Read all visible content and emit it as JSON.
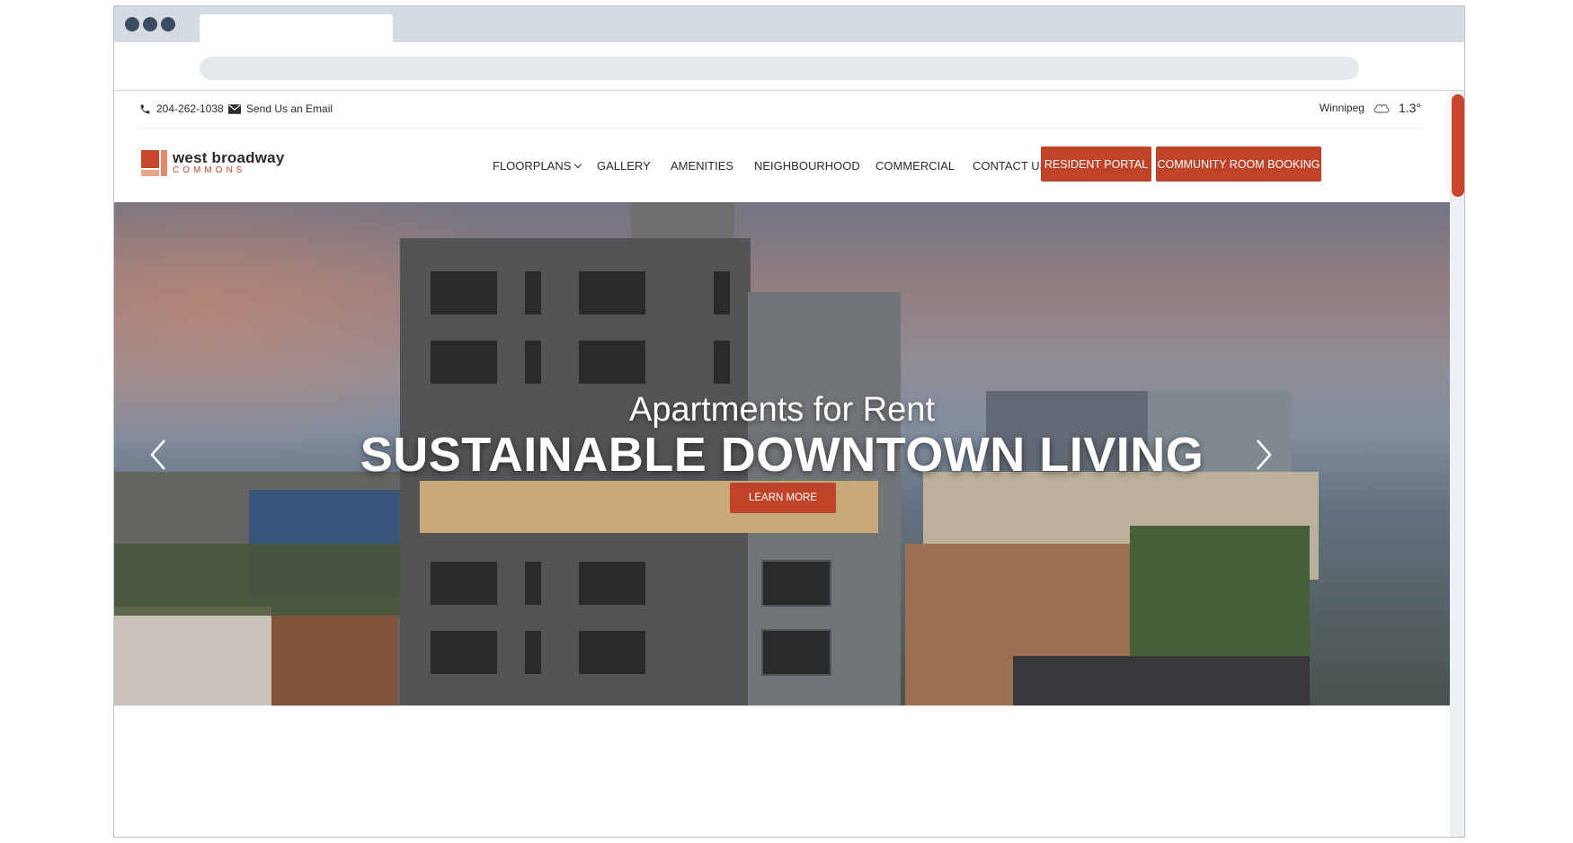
{
  "topbar": {
    "phone": "204-262-1038",
    "email_label": "Send Us an Email",
    "city": "Winnipeg",
    "temperature": "1.3°"
  },
  "logo": {
    "line1": "west broadway",
    "line2": "COMMONS"
  },
  "nav": {
    "items": [
      {
        "label": "FLOORPLANS"
      },
      {
        "label": "GALLERY"
      },
      {
        "label": "AMENITIES"
      },
      {
        "label": "NEIGHBOURHOOD"
      },
      {
        "label": "COMMERCIAL"
      },
      {
        "label": "CONTACT US"
      }
    ],
    "resident_portal": "RESIDENT PORTAL",
    "community_booking": "COMMUNITY ROOM BOOKING"
  },
  "hero": {
    "subtitle": "Apartments for Rent",
    "title": "SUSTAINABLE DOWNTOWN LIVING",
    "button": "LEARN MORE"
  },
  "colors": {
    "accent": "#bf4328",
    "scrollbar": "#c8472c"
  }
}
